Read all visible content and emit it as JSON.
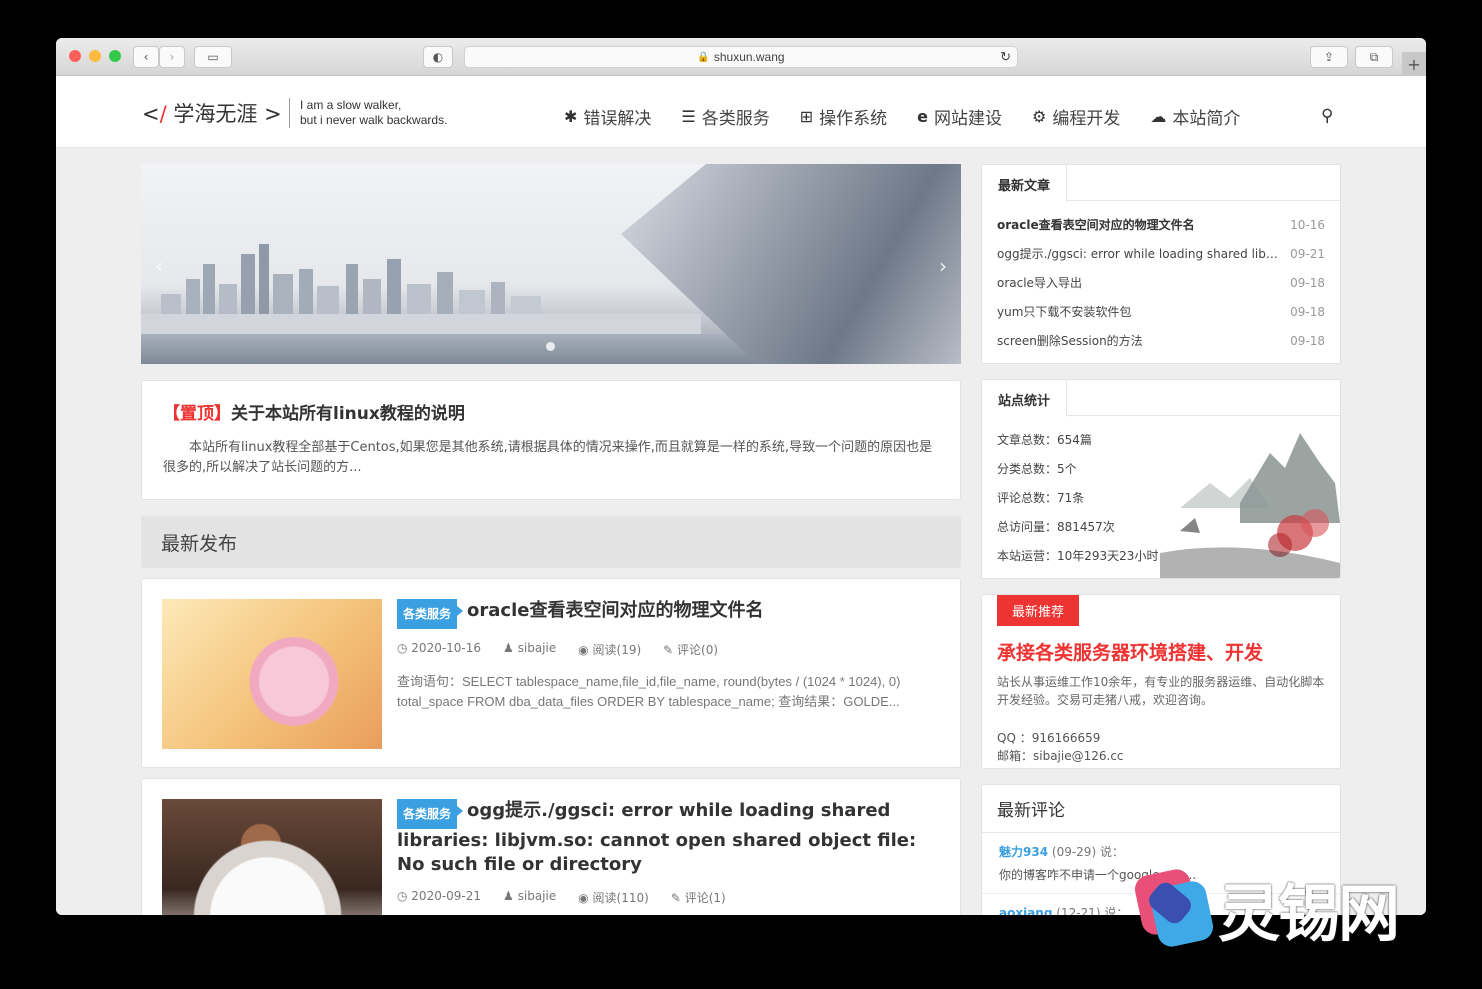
{
  "browser": {
    "url": "shuxun.wang"
  },
  "header": {
    "logo_text": "学海无涯",
    "logo_prefix": "<",
    "logo_slash": "/",
    "logo_suffix": ">",
    "slogan_line1": "I am a slow walker,",
    "slogan_line2": "but i never walk backwards.",
    "nav": [
      {
        "label": "错误解决",
        "icon": "bug-icon"
      },
      {
        "label": "各类服务",
        "icon": "server-icon"
      },
      {
        "label": "操作系统",
        "icon": "windows-icon"
      },
      {
        "label": "网站建设",
        "icon": "ie-icon"
      },
      {
        "label": "编程开发",
        "icon": "gear-icon"
      },
      {
        "label": "本站简介",
        "icon": "wechat-icon"
      }
    ]
  },
  "pinned": {
    "tag": "【置顶】",
    "title": "关于本站所有linux教程的说明",
    "text": "本站所有linux教程全部基于Centos,如果您是其他系统,请根据具体的情况来操作,而且就算是一样的系统,导致一个问题的原因也是很多的,所以解决了站长问题的方..."
  },
  "latest_section": "最新发布",
  "posts": [
    {
      "category": "各类服务",
      "title": "oracle查看表空间对应的物理文件名",
      "date": "2020-10-16",
      "author": "sibajie",
      "reads": "阅读(19)",
      "comments": "评论(0)",
      "excerpt": "查询语句：SELECT tablespace_name,file_id,file_name, round(bytes / (1024 * 1024), 0) total_space FROM dba_data_files ORDER BY tablespace_name; 查询结果：GOLDE..."
    },
    {
      "category": "各类服务",
      "title": "ogg提示./ggsci: error while loading shared libraries: libjvm.so: cannot open shared object file: No such file or directory",
      "date": "2020-09-21",
      "author": "sibajie",
      "reads": "阅读(110)",
      "comments": "评论(1)"
    }
  ],
  "sidebar": {
    "latest_title": "最新文章",
    "latest": [
      {
        "title": "oracle查看表空间对应的物理文件名",
        "date": "10-16"
      },
      {
        "title": "ogg提示./ggsci: error while loading shared librari...",
        "date": "09-21"
      },
      {
        "title": "oracle导入导出",
        "date": "09-18"
      },
      {
        "title": "yum只下载不安装软件包",
        "date": "09-18"
      },
      {
        "title": "screen删除Session的方法",
        "date": "09-18"
      }
    ],
    "stats_title": "站点统计",
    "stats": [
      "文章总数：654篇",
      "分类总数：5个",
      "评论总数：71条",
      "总访问量：881457次",
      "本站运营：10年293天23小时"
    ],
    "rec_badge": "最新推荐",
    "rec_title": "承接各类服务器环境搭建、开发",
    "rec_text": "站长从事运维工作10余年，有专业的服务器运维、自动化脚本开发经验。交易可走猪八戒，欢迎咨询。",
    "rec_qq": "QQ ：916166659",
    "rec_mail": "邮箱：sibajie@126.cc",
    "comments_title": "最新评论",
    "comments": [
      {
        "user": "魅力934",
        "when": "(09-29) 说：",
        "text": "你的博客咋不申请一个google ads..."
      },
      {
        "user": "aoxiang",
        "when": "(12-21) 说："
      }
    ]
  },
  "watermark": "灵锡网"
}
